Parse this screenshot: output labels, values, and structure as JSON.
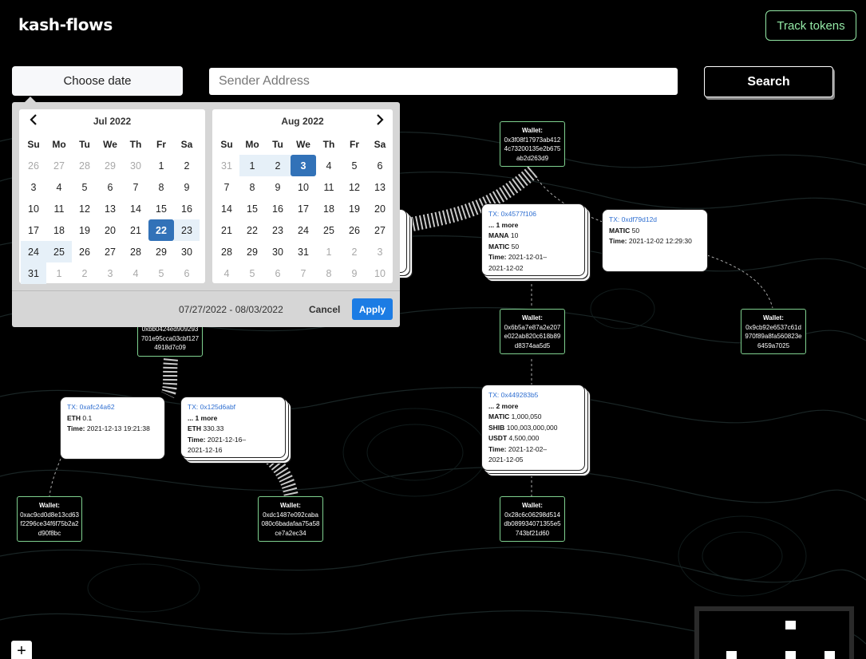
{
  "app": {
    "title": "kash-flows",
    "track_label": "Track tokens"
  },
  "controls": {
    "date_label": "Choose date",
    "search_placeholder": "Sender Address",
    "search_label": "Search"
  },
  "calendar": {
    "left_month": "Jul 2022",
    "right_month": "Aug 2022",
    "weekdays": [
      "Su",
      "Mo",
      "Tu",
      "We",
      "Th",
      "Fr",
      "Sa"
    ],
    "left_days": [
      "26",
      "27",
      "28",
      "29",
      "30",
      "1",
      "2",
      "3",
      "4",
      "5",
      "6",
      "7",
      "8",
      "9",
      "10",
      "11",
      "12",
      "13",
      "14",
      "15",
      "16",
      "17",
      "18",
      "19",
      "20",
      "21",
      "22",
      "23",
      "24",
      "25",
      "26",
      "27",
      "28",
      "29",
      "30",
      "31",
      "1",
      "2",
      "3",
      "4",
      "5",
      "6"
    ],
    "right_days": [
      "31",
      "1",
      "2",
      "3",
      "4",
      "5",
      "6",
      "7",
      "8",
      "9",
      "10",
      "11",
      "12",
      "13",
      "14",
      "15",
      "16",
      "17",
      "18",
      "19",
      "20",
      "21",
      "22",
      "23",
      "24",
      "25",
      "26",
      "27",
      "28",
      "29",
      "30",
      "31",
      "1",
      "2",
      "3",
      "4",
      "5",
      "6",
      "7",
      "8",
      "9",
      "10"
    ],
    "range_text": "07/27/2022 - 08/03/2022",
    "cancel_label": "Cancel",
    "apply_label": "Apply",
    "prev_icon": "chevron-left-icon",
    "next_icon": "chevron-right-icon"
  },
  "graph": {
    "wallet_label": "Wallet:",
    "wallets": [
      {
        "address": "0x3f08f17973ab4124c73200135e2b675ab2d263d9"
      },
      {
        "address": "0x6b5a7e87a2e207e022ab820c618b89d8374aa5d5"
      },
      {
        "address": "0x9cb92e6537c61d970f89a8fa560823e6459a7025"
      },
      {
        "address": "0x28c6c06298d514db089934071355e5743bf21d60"
      },
      {
        "address": "0xac9cd0d8e13cd63f2296ce34f6f75b2a2d90f8bc"
      },
      {
        "address": "0xdc1487e092caba080c6badafaa75a58ce7a2ec34"
      },
      {
        "address": "0xbb0424ed909293701e95cca03cbf1274918d7c09",
        "partial_label": "0xbb0424ed9092\n93701e95cca03c\nbf1274918d7c09"
      }
    ],
    "tx_prefix": "TX:",
    "txs": [
      {
        "id": "0x4577f106",
        "more": "... 1 more",
        "tokens": [
          {
            "sym": "MANA",
            "amt": "10"
          },
          {
            "sym": "MATIC",
            "amt": "50"
          }
        ],
        "time_label": "Time:",
        "time": "2021-12-01–",
        "time2": "2021-12-02"
      },
      {
        "id": "0xdf79d12d",
        "tokens": [
          {
            "sym": "MATIC",
            "amt": "50"
          }
        ],
        "time_label": "Time:",
        "time": "2021-12-02 12:29:30"
      },
      {
        "id": "0x449283b5",
        "more": "... 2 more",
        "tokens": [
          {
            "sym": "MATIC",
            "amt": "1,000,050"
          },
          {
            "sym": "SHIB",
            "amt": "100,003,000,000"
          },
          {
            "sym": "USDT",
            "amt": "4,500,000"
          }
        ],
        "time_label": "Time:",
        "time": "2021-12-02–",
        "time2": "2021-12-05"
      },
      {
        "id": "0xafc24a62",
        "tokens": [
          {
            "sym": "ETH",
            "amt": "0.1"
          }
        ],
        "time_label": "Time:",
        "time": "2021-12-13 19:21:38"
      },
      {
        "id": "0x125d6abf",
        "more": "... 1 more",
        "tokens": [
          {
            "sym": "ETH",
            "amt": "330.33"
          }
        ],
        "time_label": "Time:",
        "time": "2021-12-16–",
        "time2": "2021-12-16"
      }
    ]
  },
  "misc": {
    "zoom_in_label": "+",
    "colors": {
      "accent": "#93e8a5",
      "apply": "#1c7ce4",
      "selected": "#3272b8"
    }
  }
}
